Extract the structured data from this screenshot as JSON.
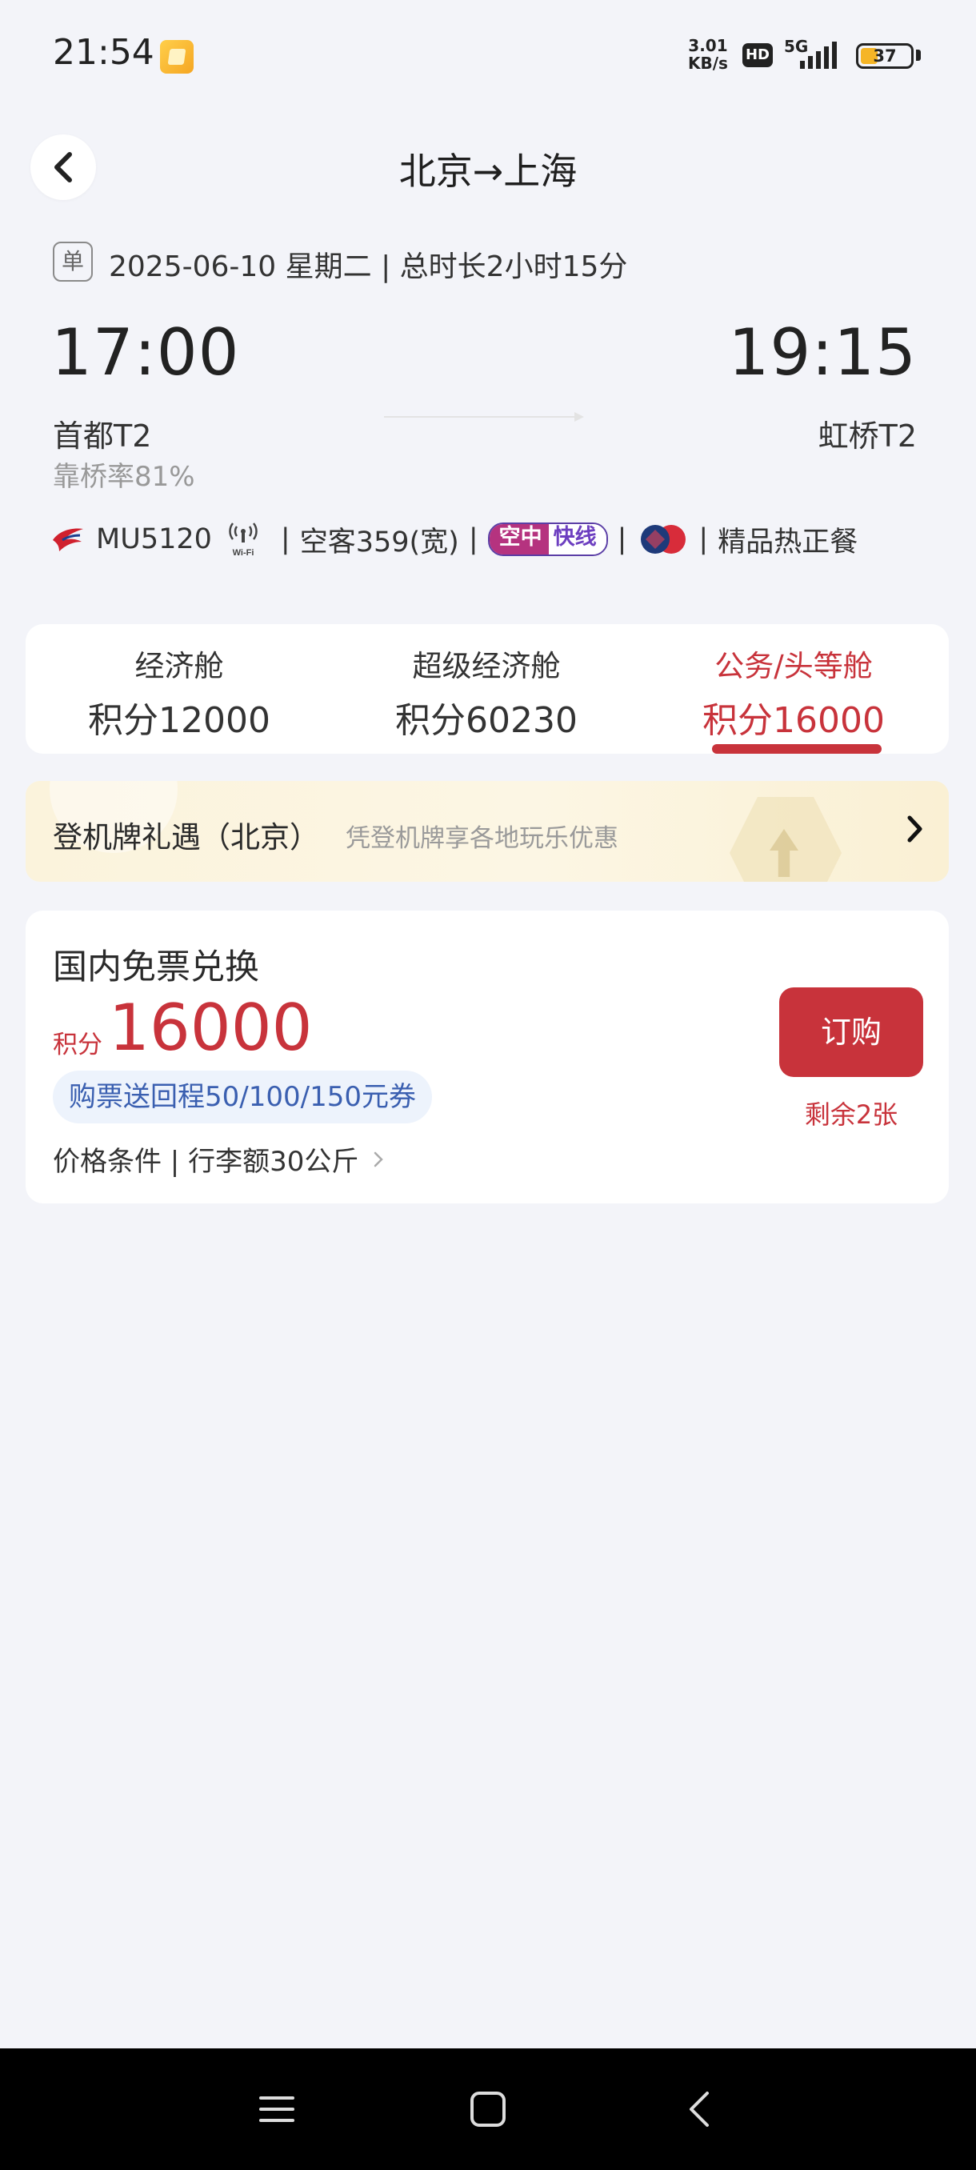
{
  "status_bar": {
    "time": "21:54",
    "net_speed_value": "3.01",
    "net_speed_unit": "KB/s",
    "hd_label": "HD",
    "network": "5G",
    "battery": "37"
  },
  "header": {
    "title": "北京→上海"
  },
  "flight": {
    "trip_tag": "单",
    "date_line": "2025-06-10 星期二 | 总时长2小时15分",
    "departure_time": "17:00",
    "arrival_time": "19:15",
    "departure_airport": "首都T2",
    "arrival_airport": "虹桥T2",
    "bridge_rate": "靠桥率81%",
    "flight_number": "MU5120",
    "aircraft": "空客359(宽)",
    "express_label_a": "空中",
    "express_label_b": "快线",
    "meal": "精品热正餐",
    "separator": "|"
  },
  "cabins": [
    {
      "name": "经济舱",
      "price": "积分12000"
    },
    {
      "name": "超级经济舱",
      "price": "积分60230"
    },
    {
      "name": "公务/头等舱",
      "price": "积分16000",
      "active": true
    }
  ],
  "promo": {
    "title": "登机牌礼遇（北京）",
    "subtitle": "凭登机牌享各地玩乐优惠"
  },
  "exchange": {
    "title": "国内免票兑换",
    "price_label": "积分",
    "price": "16000",
    "coupon": "购票送回程50/100/150元券",
    "conditions": "价格条件 | 行李额30公斤",
    "book_label": "订购",
    "remaining": "剩余2张"
  },
  "colors": {
    "accent": "#c8333b",
    "background": "#f3f4f9",
    "coupon_text": "#3a5fb0",
    "coupon_bg": "#edf3fc"
  },
  "icons": {
    "back": "chevron-left-icon",
    "airline": "china-eastern-logo",
    "wifi": "wifi-icon",
    "meal": "meal-brand-icon",
    "promo_arrow": "chevron-right-icon",
    "nav": [
      "menu-icon",
      "home-icon",
      "back-icon"
    ]
  }
}
